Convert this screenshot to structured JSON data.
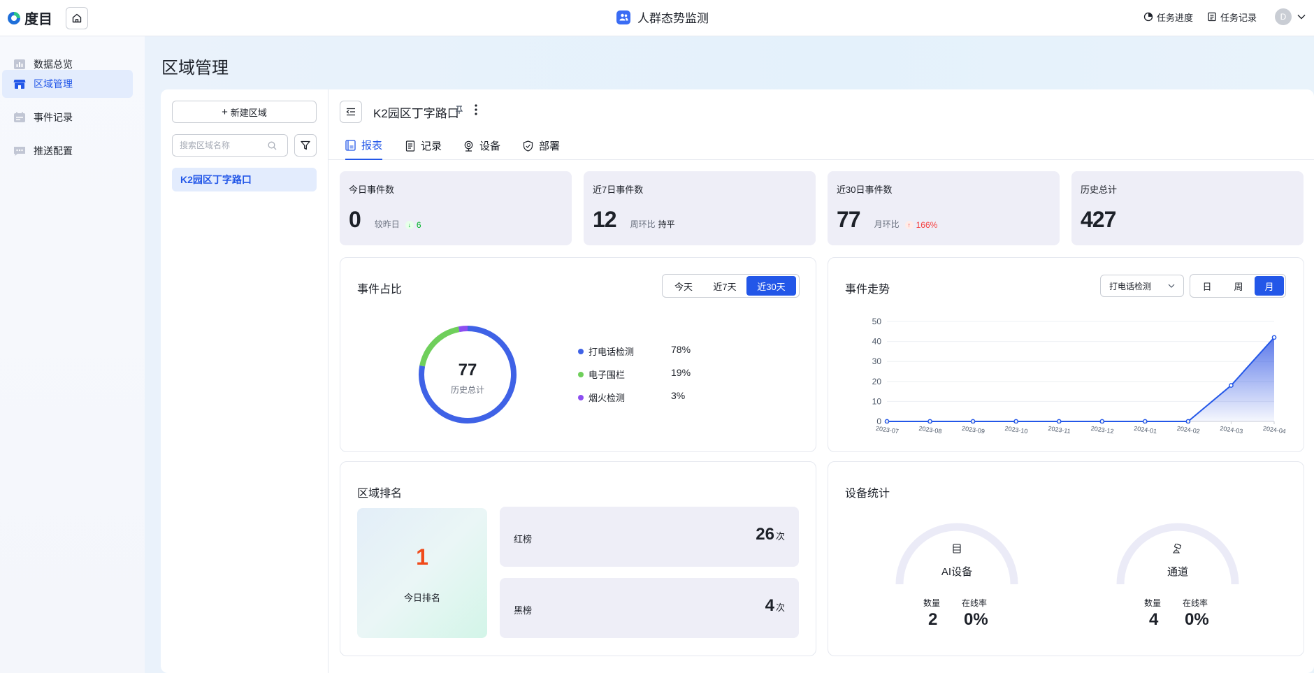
{
  "brand": {
    "name": "度目"
  },
  "app_title": "人群态势监测",
  "top_links": {
    "progress": "任务进度",
    "records": "任务记录"
  },
  "user": {
    "initial": "D"
  },
  "sidebar": {
    "items": [
      {
        "label": "数据总览",
        "icon": "bar-chart-icon"
      },
      {
        "label": "区域管理",
        "icon": "store-icon"
      },
      {
        "label": "事件记录",
        "icon": "record-icon"
      },
      {
        "label": "推送配置",
        "icon": "message-icon"
      }
    ]
  },
  "page": {
    "title": "区域管理"
  },
  "area_panel": {
    "new_button": "新建区域",
    "search_placeholder": "搜索区域名称",
    "areas": [
      "K2园区丁字路口"
    ]
  },
  "detail": {
    "name": "K2园区丁字路口",
    "tabs": [
      {
        "label": "报表",
        "icon": "report-icon"
      },
      {
        "label": "记录",
        "icon": "document-icon"
      },
      {
        "label": "设备",
        "icon": "camera-icon"
      },
      {
        "label": "部署",
        "icon": "shield-icon"
      }
    ]
  },
  "stats": [
    {
      "label": "今日事件数",
      "value": "0",
      "compare_label": "较昨日",
      "delta": "6",
      "delta_dir": "down"
    },
    {
      "label": "近7日事件数",
      "value": "12",
      "compare_label": "周环比",
      "delta": "持平",
      "delta_dir": "flat"
    },
    {
      "label": "近30日事件数",
      "value": "77",
      "compare_label": "月环比",
      "delta": "166%",
      "delta_dir": "up"
    },
    {
      "label": "历史总计",
      "value": "427"
    }
  ],
  "event_ratio": {
    "title": "事件占比",
    "ranges": [
      "今天",
      "近7天",
      "近30天"
    ],
    "active_range": "近30天",
    "center_value": "77",
    "center_label": "历史总计"
  },
  "event_trend": {
    "title": "事件走势",
    "select_value": "打电话检测",
    "granularity": [
      "日",
      "周",
      "月"
    ],
    "active_granularity": "月"
  },
  "area_rank": {
    "title": "区域排名",
    "today_rank": "1",
    "today_label": "今日排名",
    "red_label": "红榜",
    "red_value": "26",
    "black_label": "黑榜",
    "black_value": "4",
    "unit": "次"
  },
  "device_stats": {
    "title": "设备统计",
    "devices": [
      {
        "name": "AI设备",
        "count_label": "数量",
        "count": "2",
        "online_label": "在线率",
        "online": "0%",
        "icon": "server-icon"
      },
      {
        "name": "通道",
        "count_label": "数量",
        "count": "4",
        "online_label": "在线率",
        "online": "0%",
        "icon": "camera-channel-icon"
      }
    ]
  },
  "colors": {
    "accent": "#2357e8",
    "phone": "#3f62e6",
    "fence": "#6fcf5b",
    "fire": "#8c4ef0",
    "up": "#f53f3f",
    "down": "#00b42a"
  },
  "chart_data": [
    {
      "type": "pie",
      "labels": [
        "打电话检测",
        "电子围栏",
        "烟火检测"
      ],
      "values": [
        78,
        19,
        3
      ],
      "value_labels": [
        "78%",
        "19%",
        "3%"
      ],
      "colors": [
        "#3f62e6",
        "#6fcf5b",
        "#8c4ef0"
      ]
    },
    {
      "type": "area",
      "x": [
        "2023-07",
        "2023-08",
        "2023-09",
        "2023-10",
        "2023-11",
        "2023-12",
        "2024-01",
        "2024-02",
        "2024-03",
        "2024-04"
      ],
      "values": [
        0,
        0,
        0,
        0,
        0,
        0,
        0,
        0,
        18,
        42
      ],
      "ylim": [
        0,
        50
      ],
      "yticks": [
        "0",
        "10",
        "20",
        "30",
        "40",
        "50"
      ],
      "grid": true
    }
  ]
}
